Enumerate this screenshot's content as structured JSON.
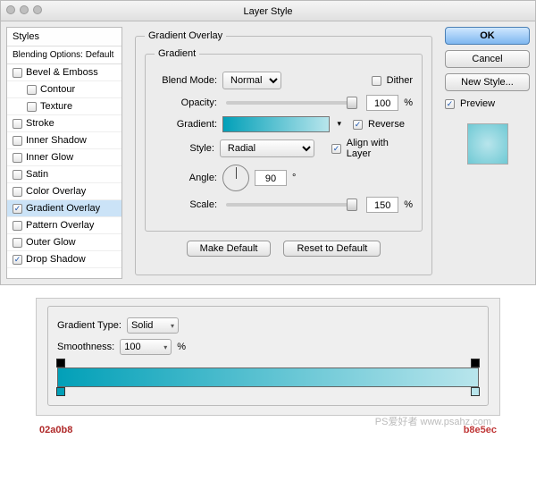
{
  "window": {
    "title": "Layer Style"
  },
  "sidebar": {
    "header": "Styles",
    "blending": "Blending Options: Default",
    "items": [
      {
        "label": "Bevel & Emboss",
        "checked": false,
        "child": false
      },
      {
        "label": "Contour",
        "checked": false,
        "child": true
      },
      {
        "label": "Texture",
        "checked": false,
        "child": true
      },
      {
        "label": "Stroke",
        "checked": false,
        "child": false
      },
      {
        "label": "Inner Shadow",
        "checked": false,
        "child": false
      },
      {
        "label": "Inner Glow",
        "checked": false,
        "child": false
      },
      {
        "label": "Satin",
        "checked": false,
        "child": false
      },
      {
        "label": "Color Overlay",
        "checked": false,
        "child": false
      },
      {
        "label": "Gradient Overlay",
        "checked": true,
        "child": false,
        "selected": true
      },
      {
        "label": "Pattern Overlay",
        "checked": false,
        "child": false
      },
      {
        "label": "Outer Glow",
        "checked": false,
        "child": false
      },
      {
        "label": "Drop Shadow",
        "checked": true,
        "child": false
      }
    ]
  },
  "panel": {
    "group_title": "Gradient Overlay",
    "subgroup_title": "Gradient",
    "blendmode_label": "Blend Mode:",
    "blendmode_value": "Normal",
    "dither_label": "Dither",
    "dither_checked": false,
    "opacity_label": "Opacity:",
    "opacity_value": "100",
    "percent": "%",
    "gradient_label": "Gradient:",
    "reverse_label": "Reverse",
    "reverse_checked": true,
    "style_label": "Style:",
    "style_value": "Radial",
    "align_label": "Align with Layer",
    "align_checked": true,
    "angle_label": "Angle:",
    "angle_value": "90",
    "deg": "°",
    "scale_label": "Scale:",
    "scale_value": "150",
    "make_default": "Make Default",
    "reset_default": "Reset to Default"
  },
  "right": {
    "ok": "OK",
    "cancel": "Cancel",
    "newstyle": "New Style...",
    "preview_label": "Preview",
    "preview_checked": true
  },
  "editor": {
    "type_label": "Gradient Type:",
    "type_value": "Solid",
    "smooth_label": "Smoothness:",
    "smooth_value": "100",
    "percent": "%",
    "hex_left": "02a0b8",
    "hex_right": "b8e5ec"
  },
  "watermark": "PS爱好者 www.psahz.com"
}
